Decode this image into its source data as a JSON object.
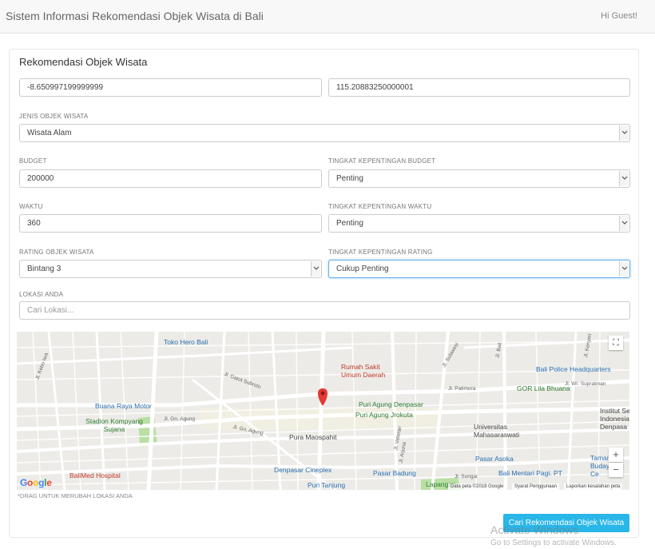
{
  "header": {
    "title": "Sistem Informasi Rekomendasi Objek Wisata di Bali",
    "greeting": "Hi Guest!"
  },
  "form": {
    "title": "Rekomendasi Objek Wisata",
    "latitude": "-8.650997199999999",
    "longitude": "115.20883250000001",
    "jenis": {
      "label": "JENIS OBJEK WISATA",
      "value": "Wisata Alam"
    },
    "budget": {
      "label": "BUDGET",
      "value": "200000"
    },
    "tk_budget": {
      "label": "TINGKAT KEPENTINGAN BUDGET",
      "value": "Penting"
    },
    "waktu": {
      "label": "WAKTU",
      "value": "360"
    },
    "tk_waktu": {
      "label": "TINGKAT KEPENTINGAN WAKTU",
      "value": "Penting"
    },
    "rating": {
      "label": "RATING OBJEK WISATA",
      "value": "Bintang 3"
    },
    "tk_rating": {
      "label": "TINGKAT KEPENTINGAN RATING",
      "value": "Cukup Penting"
    },
    "lokasi": {
      "label": "LOKASI ANDA",
      "placeholder": "Cari Lokasi..."
    },
    "hint": "*DRAG UNTUK MERUBAH LOKASI ANDA",
    "submit": "Cari Rekomendasi Objek Wisata"
  },
  "map": {
    "places": {
      "toko_hero": "Toko Hero Bali",
      "rs": "Rumah Sakit Umum Daerah",
      "police": "Bali Police Headquarters",
      "gor": "GOR Lila Bhuana",
      "buana": "Buana Raya Motor",
      "stadion": "Stadion Kompyang Sujana",
      "puri_agung": "Puri Agung Denpasar",
      "puri_jro": "Puri Agung Jrokuta",
      "univ": "Universitas Mahasaraswati",
      "institut": "Institut Se Indonesia Denpasa",
      "pura": "Pura Maospahit",
      "cineplex": "Denpasar Cineplex",
      "pasar_badung": "Pasar Badung",
      "pasar_asoka": "Pasar Asoka",
      "bali_mentari": "Bali Mentari Pagi. PT",
      "taman": "Taman We Budaya Art Ce",
      "balimed": "BaliMed Hospital",
      "puri_tanjung": "Puri Tanjung",
      "lapangan": "Lapangan",
      "s_patimura": "Jl. Patimura",
      "s_supratman": "Jl. Wr. Supratman",
      "s_gn_agung": "Jl. Gn. Agung",
      "s_gn_agung2": "Jl. Gn. Agung",
      "s_kebo": "Jl. Kebo Iwa",
      "s_gatot": "Jl. Gatot Subroto",
      "s_veteran": "Jl. Veteran",
      "s_arjuna": "Jl. Arjuna",
      "s_sulawesi": "Jl. Sulawesi",
      "s_sungai": "Jl. Sungai",
      "s_bali": "Jl. Bali",
      "s_kenyeri": "Jl. Kenyeri"
    },
    "footer": {
      "data": "Data peta ©2018 Google",
      "terms": "Syarat Penggunaan",
      "report": "Laporkan kesalahan peta"
    },
    "google": "Google"
  },
  "watermark": {
    "line1": "Activate Windows",
    "line2": "Go to Settings to activate Windows."
  },
  "colors": {
    "accent": "#29b6e8",
    "pin": "#e53935",
    "park": "#b9dfa3",
    "road": "#ffffff",
    "map_bg": "#ecebe7"
  }
}
